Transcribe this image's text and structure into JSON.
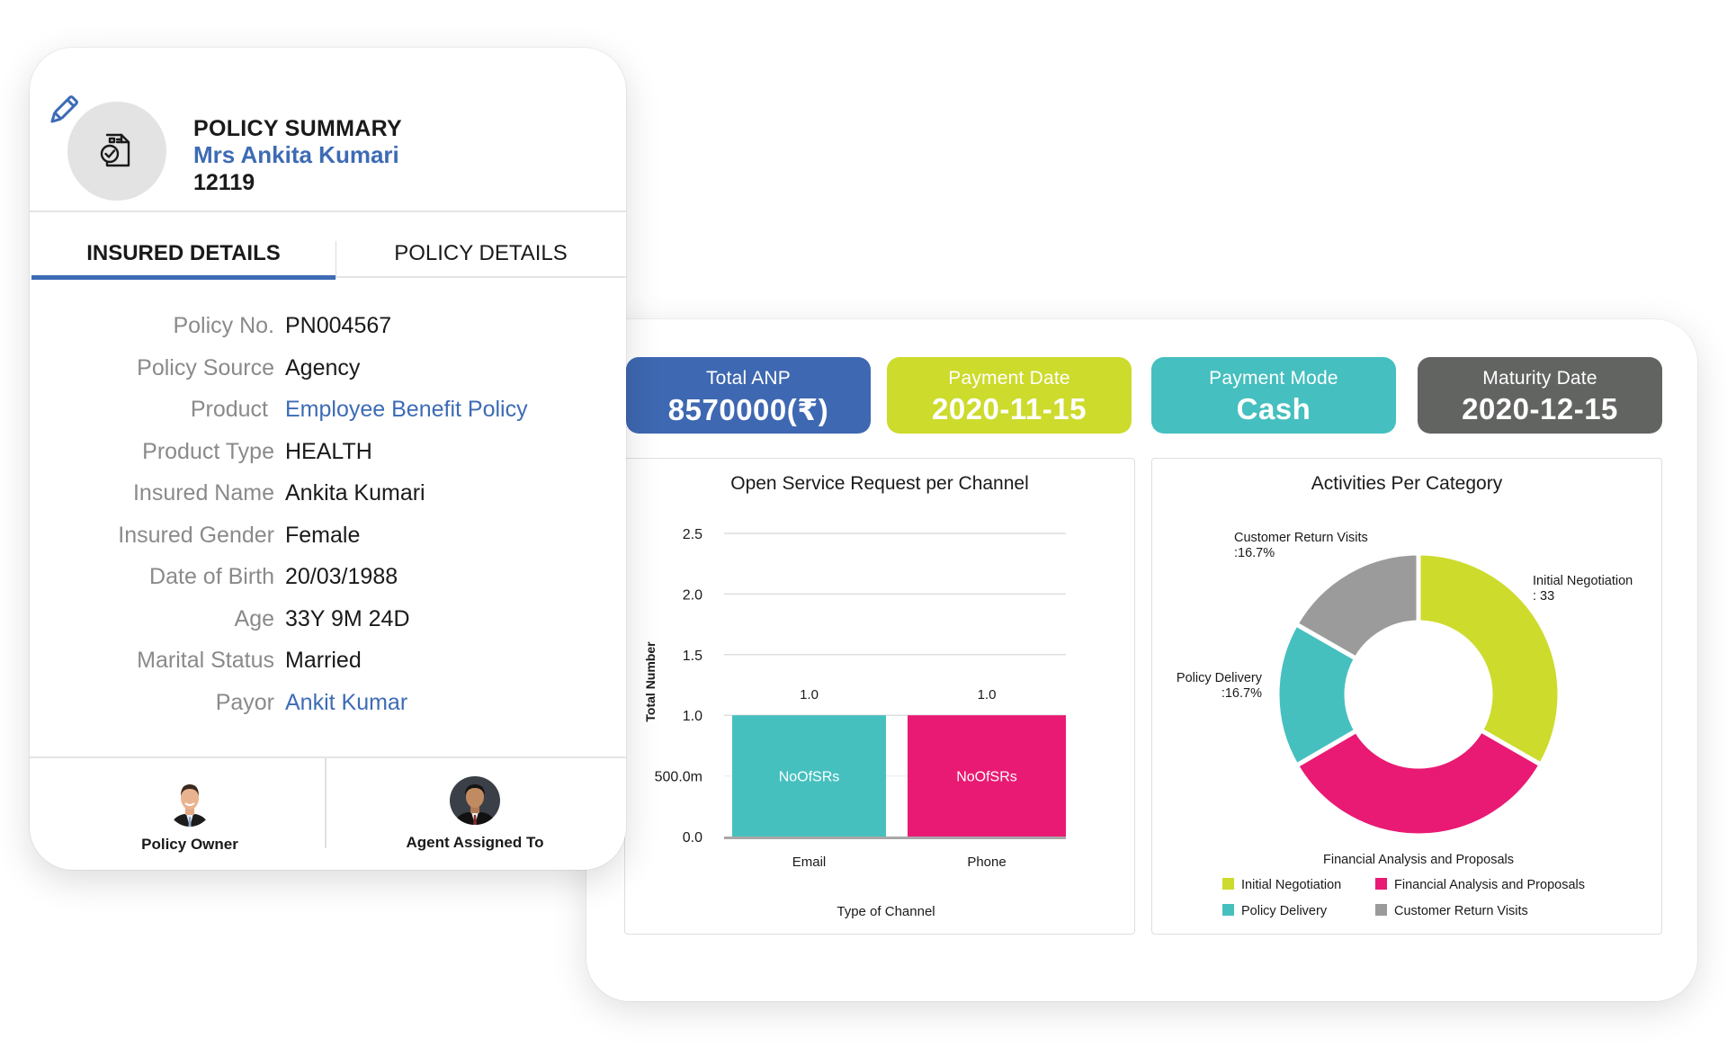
{
  "policy_card": {
    "title": "POLICY SUMMARY",
    "holder_name": "Mrs Ankita Kumari",
    "holder_id": "12119",
    "edit_icon": "pencil-icon",
    "document_icon": "document-check-icon",
    "tabs": [
      {
        "label": "INSURED DETAILS",
        "active": true
      },
      {
        "label": "POLICY DETAILS",
        "active": false
      }
    ],
    "details": [
      {
        "label": "Policy No.",
        "value": "PN004567",
        "link": false
      },
      {
        "label": "Policy Source",
        "value": "Agency",
        "link": false
      },
      {
        "label": "Product",
        "value": "Employee Benefit Policy",
        "link": true
      },
      {
        "label": "Product Type",
        "value": "HEALTH",
        "link": false
      },
      {
        "label": "Insured Name",
        "value": "Ankita Kumari",
        "link": false
      },
      {
        "label": "Insured Gender",
        "value": "Female",
        "link": false
      },
      {
        "label": "Date of Birth",
        "value": "20/03/1988",
        "link": false
      },
      {
        "label": "Age",
        "value": "33Y 9M 24D",
        "link": false
      },
      {
        "label": "Marital Status",
        "value": "Married",
        "link": false
      },
      {
        "label": "Payor",
        "value": "Ankit Kumar",
        "link": true
      }
    ],
    "footer": [
      {
        "label": "Policy Owner",
        "icon": "avatar-policy-owner"
      },
      {
        "label": "Agent Assigned To",
        "icon": "avatar-agent"
      }
    ],
    "accent_color": "#3d6bb5"
  },
  "stats": [
    {
      "label": "Total ANP",
      "value": "8570000(₹)",
      "color": "#3e68b1"
    },
    {
      "label": "Payment Date",
      "value": "2020-11-15",
      "color": "#cddb2c"
    },
    {
      "label": "Payment Mode",
      "value": "Cash",
      "color": "#45bfbf"
    },
    {
      "label": "Maturity Date",
      "value": "2020-12-15",
      "color": "#626462"
    }
  ],
  "chart_data": [
    {
      "type": "bar",
      "title": "Open Service Request per Channel",
      "xlabel": "Type of Channel",
      "ylabel": "Total Number",
      "categories": [
        "Email",
        "Phone"
      ],
      "series": [
        {
          "name": "NoOfSRs",
          "values": [
            1.0,
            1.0
          ]
        }
      ],
      "bar_labels": [
        "NoOfSRs",
        "NoOfSRs"
      ],
      "data_labels": [
        "1.0",
        "1.0"
      ],
      "colors": [
        "#46c0bf",
        "#e91a73"
      ],
      "ylim": [
        0,
        2.5
      ],
      "yticks": [
        0,
        0.5,
        1.0,
        1.5,
        2.0,
        2.5
      ],
      "ytick_labels": [
        "0.0",
        "500.0m",
        "1.0",
        "1.5",
        "2.0",
        "2.5"
      ],
      "grid": true
    },
    {
      "type": "pie",
      "donut": true,
      "title": "Activities Per Category",
      "categories": [
        "Initial Negotiation",
        "Financial Analysis and Proposals",
        "Policy Delivery",
        "Customer Return Visits"
      ],
      "values": [
        33.3,
        33.3,
        16.7,
        16.7
      ],
      "colors": [
        "#cddb2c",
        "#e91a73",
        "#46c0bf",
        "#9b9b9b"
      ],
      "slice_labels": [
        [
          "Initial Negotiation",
          ": 33"
        ],
        [
          "Financial Analysis and Proposals"
        ],
        [
          "Policy Delivery",
          ":16.7%"
        ],
        [
          "Customer Return Visits",
          ":16.7%"
        ]
      ],
      "legend": "bottom"
    }
  ]
}
